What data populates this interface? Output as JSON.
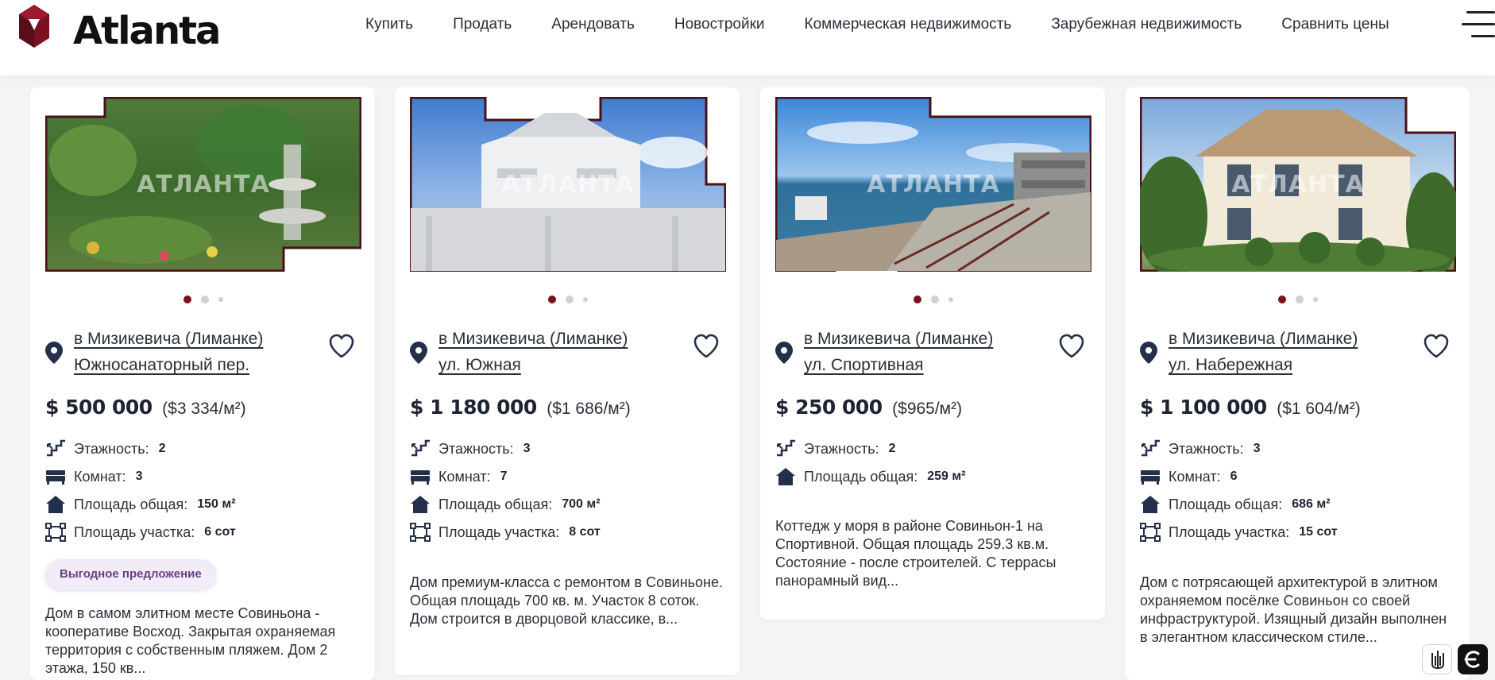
{
  "brand": {
    "name": "Atlanta",
    "accent": "#7a1020",
    "accent_dark": "#5a0e1c"
  },
  "nav": {
    "items": [
      {
        "label": "Купить"
      },
      {
        "label": "Продать"
      },
      {
        "label": "Арендовать"
      },
      {
        "label": "Новостройки"
      },
      {
        "label": "Коммерческая недвижимость"
      },
      {
        "label": "Зарубежная недвижимость"
      },
      {
        "label": "Сравнить цены"
      }
    ],
    "menu_icon": "hamburger-icon"
  },
  "feature_labels": {
    "floors": "Этажность:",
    "rooms": "Комнат:",
    "area": "Площадь общая:",
    "plot": "Площадь участка:"
  },
  "watermark": "АТЛАНТА",
  "cards": [
    {
      "address_line1": "в Мизикевича (Лиманке)",
      "address_line2": "Южносанаторный пер.",
      "price": "$ 500 000",
      "price_per_m2": "($3 334/м²)",
      "floors": "2",
      "rooms": "3",
      "area": "150 м²",
      "plot": "6 сот",
      "badge": "Выгодное предложение",
      "description": "Дом в самом элитном месте Совиньона - кооперативе Восход. Закрытая охраняемая территория с собственным пляжем. Дом 2 этажа, 150 кв...",
      "photo_page": 1,
      "photo_pages": 3
    },
    {
      "address_line1": "в Мизикевича (Лиманке)",
      "address_line2": "ул. Южная",
      "price": "$ 1 180 000",
      "price_per_m2": "($1 686/м²)",
      "floors": "3",
      "rooms": "7",
      "area": "700 м²",
      "plot": "8 сот",
      "description": "Дом премиум-класса с ремонтом в Совиньоне. Общая площадь 700 кв. м. Участок 8 соток. Дом строится в дворцовой классике, в...",
      "photo_page": 1,
      "photo_pages": 3
    },
    {
      "address_line1": "в Мизикевича (Лиманке)",
      "address_line2": "ул. Спортивная",
      "price": "$ 250 000",
      "price_per_m2": "($965/м²)",
      "floors": "2",
      "area": "259 м²",
      "description": "Коттедж у моря в районе Совиньон-1 на Спортивной. Общая площадь 259.3 кв.м. Состояние - после строителей. С террасы панорамный вид...",
      "photo_page": 1,
      "photo_pages": 3
    },
    {
      "address_line1": "в Мизикевича (Лиманке)",
      "address_line2": "ул. Набережная",
      "price": "$ 1 100 000",
      "price_per_m2": "($1 604/м²)",
      "floors": "3",
      "rooms": "6",
      "area": "686 м²",
      "plot": "15 сот",
      "description": "Дом с потрясающей архитектурой в элитном охраняемом посёлке Совиньон со своей инфраструктурой. Изящный дизайн выполнен в элегантном классическом стиле...",
      "photo_page": 1,
      "photo_pages": 3
    }
  ],
  "floating_buttons": [
    {
      "icon": "trident-icon"
    },
    {
      "icon": "euro-sign-icon"
    }
  ]
}
